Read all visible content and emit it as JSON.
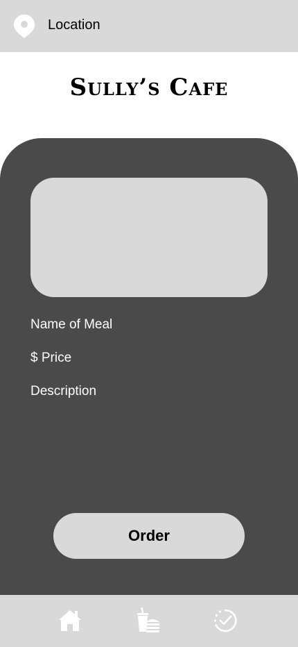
{
  "header": {
    "location_icon": "map-pin-icon",
    "location_label": "Location"
  },
  "brand": {
    "name": "Sully’s Cafe"
  },
  "meal": {
    "name": "Name of Meal",
    "price": "$ Price",
    "description": "Description"
  },
  "actions": {
    "order_label": "Order"
  },
  "bottom_nav": {
    "items": [
      {
        "icon": "home-icon"
      },
      {
        "icon": "food-drink-icon"
      },
      {
        "icon": "check-circle-icon"
      }
    ]
  },
  "colors": {
    "bar_background": "#d9d9d9",
    "card_background": "#4a4a4a",
    "text_on_card": "#ffffff",
    "icon_fill": "#ffffff"
  }
}
